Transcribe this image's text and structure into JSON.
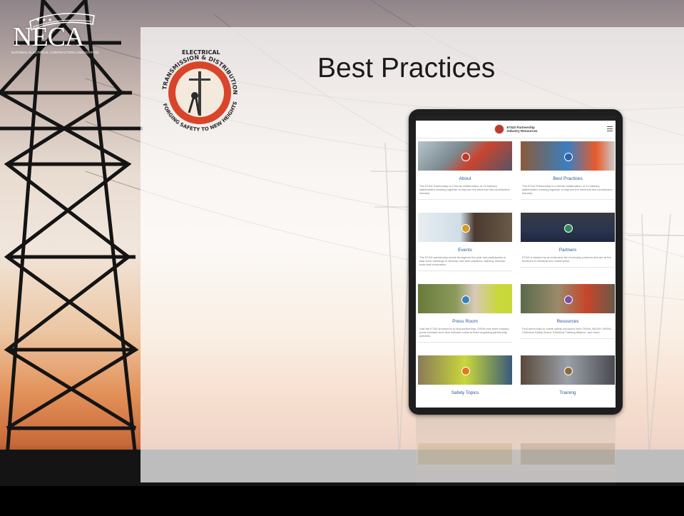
{
  "slide": {
    "title": "Best Practices"
  },
  "logos": {
    "neca_word": "NECA",
    "neca_subtitle": "NATIONAL ELECTRICAL CONTRACTORS ASSOCIATION",
    "seal_top": "ELECTRICAL",
    "seal_ring": "TRANSMISSION & DISTRIBUTION PARTNERSHIP",
    "seal_bottom": "FORGING SAFETY TO NEW HEIGHTS"
  },
  "tablet": {
    "header_line1": "ET&D Partnership",
    "header_line2": "Industry Resources",
    "cards": [
      {
        "title": "About",
        "desc": "The ET&D Partnership is a formal collaboration of 13 industry stakeholders working together to improve the electrical line construction industry.",
        "badge_color": "#c0392b"
      },
      {
        "title": "Best Practices",
        "desc": "The ET&D Partnership is a formal collaboration of 13 industry stakeholders working together to improve the electrical line construction industry.",
        "badge_color": "#2f5fa8"
      },
      {
        "title": "Events",
        "desc": "The ET&D partnership meets throughout the year and participates in task force meetings to develop new best practices, training, industry tools and information.",
        "badge_color": "#d99a1e"
      },
      {
        "title": "Partners",
        "desc": "ET&D is backed by an extensive list of industry partners that are at the forefront of electrical line construction.",
        "badge_color": "#2e8b57"
      },
      {
        "title": "Press Room",
        "desc": "Visit the ET&D pressroom to find partnership, OSHA and other industry press releases and view relevant online articles regarding partnership activities.",
        "badge_color": "#3a7fc0"
      },
      {
        "title": "Resources",
        "desc": "Find direct links to online safety resources from OSHA, NIOSH, MSHA, Chemical Safety Board, Electrical Training Alliance, and more.",
        "badge_color": "#7b4fa8"
      },
      {
        "title": "Safety Topics",
        "desc": "",
        "badge_color": "#e07a1e"
      },
      {
        "title": "Training",
        "desc": "",
        "badge_color": "#8a6a3a"
      }
    ]
  },
  "colors": {
    "title_text": "#1a1a1a",
    "card_title": "#2a5a9a",
    "panel": "#ffffff"
  }
}
